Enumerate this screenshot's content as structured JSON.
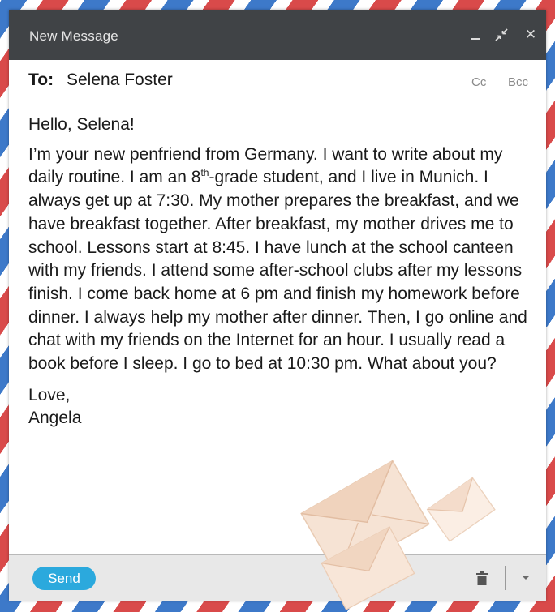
{
  "window": {
    "title": "New Message"
  },
  "titlebar_icons": [
    "minimize-icon",
    "expand-icon",
    "close-icon"
  ],
  "recipient": {
    "label": "To:",
    "value": "Selena Foster",
    "cc_label": "Cc",
    "bcc_label": "Bcc"
  },
  "body": {
    "greeting": "Hello, Selena!",
    "message_before_sup": "I’m your new penfriend from Germany. I want to write about my daily routine. I am an 8",
    "superscript": "th",
    "message_after_sup": "-grade student, and I live in Munich. I always get up at 7:30. My mother prepares the breakfast, and we have breakfast together. After breakfast, my mother drives me to school. Lessons start at 8:45. I have lunch at the school canteen with my friends. I attend some after-school clubs after my lessons finish. I come back home at 6 pm and finish my homework before dinner. I always help my mother after dinner. Then, I go online and chat with my friends on the Internet for an hour. I usually read a book before I sleep. I go to bed at 10:30 pm. What about you?",
    "closing": "Love,",
    "signature": "Angela"
  },
  "footer": {
    "send_label": "Send"
  },
  "colors": {
    "titlebar_bg": "#404346",
    "send_button": "#2ba9dd",
    "airmail_red": "#d94a4a",
    "airmail_blue": "#3d79c9",
    "footer_bg": "#e8e8e8"
  }
}
